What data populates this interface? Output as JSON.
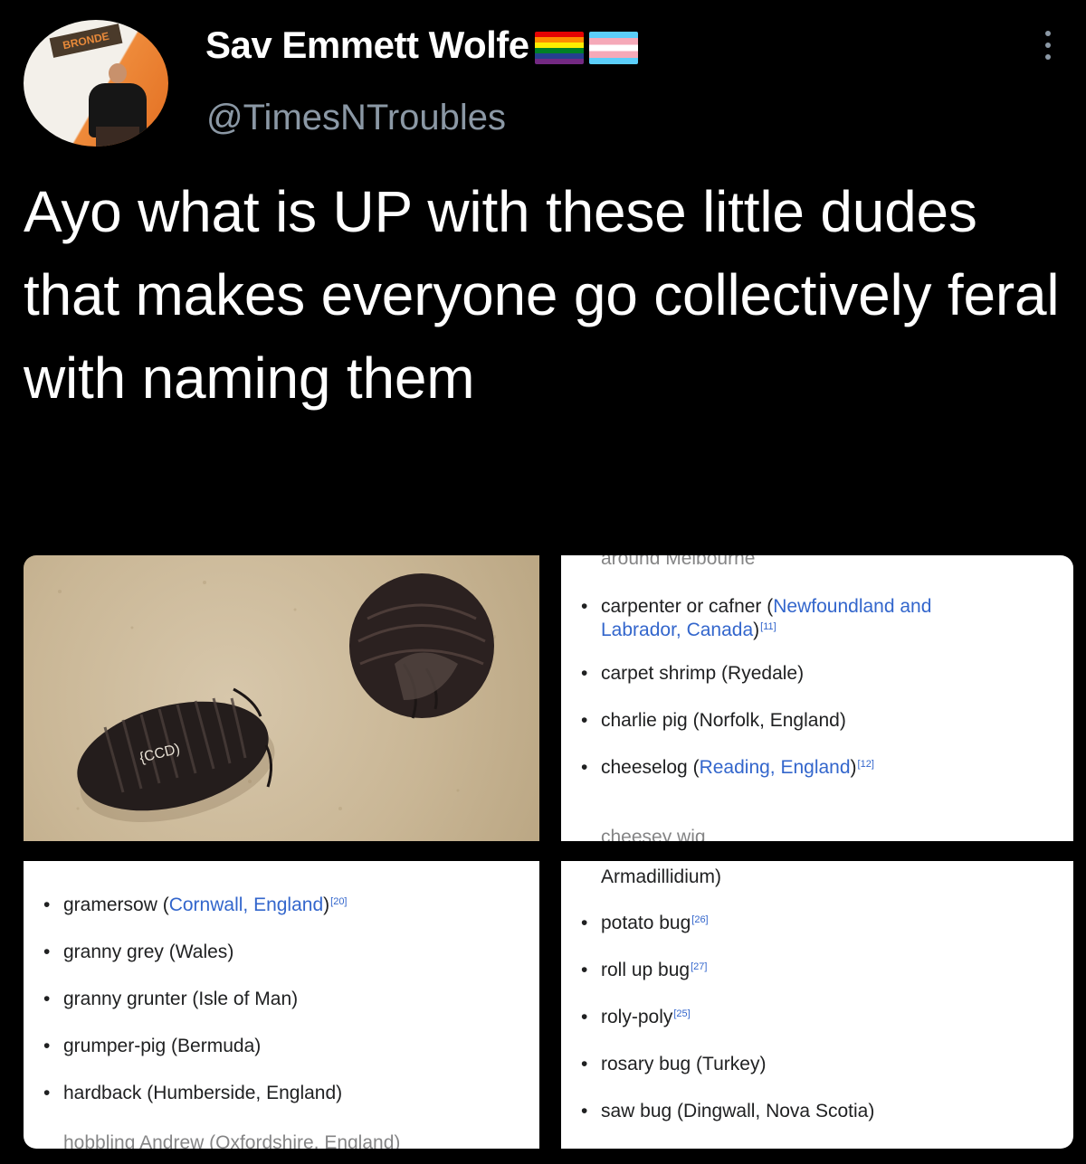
{
  "header": {
    "avatar_sign_text": "BRONDE",
    "display_name": "Sav Emmett Wolfe",
    "handle": "@TimesNTroubles",
    "flags": [
      "pride-flag-icon",
      "trans-flag-icon"
    ]
  },
  "tweet": {
    "text": "Ayo what is UP with these little dudes that makes everyone go collectively feral with naming them"
  },
  "list_top_right": {
    "cut_top": "around Melbourne",
    "items": [
      {
        "name": "carpenter or cafner",
        "place": "Newfoundland and Labrador, Canada",
        "ref": "[11]"
      },
      {
        "name": "carpet shrimp",
        "place": "Ryedale",
        "ref": ""
      },
      {
        "name": "charlie pig",
        "place": "Norfolk, England",
        "ref": ""
      },
      {
        "name": "cheeselog",
        "place": "Reading, England",
        "ref": "[12]"
      }
    ],
    "cut_bottom": "cheesey wig"
  },
  "list_bottom_left": {
    "items": [
      {
        "name": "gramersow",
        "place": "Cornwall, England",
        "ref": "[20]"
      },
      {
        "name": "granny grey",
        "place": "Wales",
        "ref": ""
      },
      {
        "name": "granny grunter",
        "place": "Isle of Man",
        "ref": ""
      },
      {
        "name": "grumper-pig",
        "place": "Bermuda",
        "ref": ""
      },
      {
        "name": "hardback",
        "place": "Humberside, England",
        "ref": ""
      }
    ],
    "cut_bottom": "hobbling Andrew (Oxfordshire, England)"
  },
  "list_bottom_right": {
    "cut_top": "Armadillidium)",
    "items": [
      {
        "name": "potato bug",
        "place": "",
        "ref": "[26]"
      },
      {
        "name": "roll up bug",
        "place": "",
        "ref": "[27]"
      },
      {
        "name": "roly-poly",
        "place": "",
        "ref": "[25]"
      },
      {
        "name": "rosary bug",
        "place": "Turkey",
        "ref": ""
      },
      {
        "name": "saw bug",
        "place": "Dingwall, Nova Scotia",
        "ref": ""
      }
    ]
  },
  "colors": {
    "background": "#000000",
    "handle_gray": "#8b98a5",
    "wiki_link": "#3366cc"
  }
}
